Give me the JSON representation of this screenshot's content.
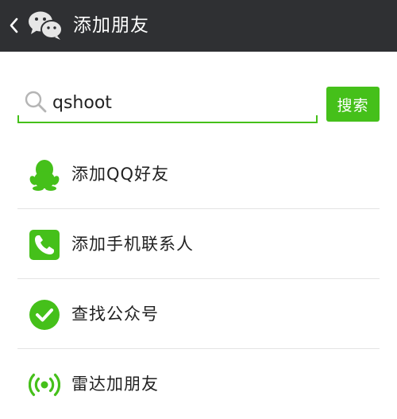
{
  "header": {
    "title": "添加朋友",
    "back_icon": "chevron-left-icon",
    "logo_icon": "wechat-logo-icon"
  },
  "search": {
    "value": "qshoot",
    "icon": "search-icon",
    "button_label": "搜索"
  },
  "menu": [
    {
      "label": "添加QQ好友",
      "icon": "qq-penguin-icon"
    },
    {
      "label": "添加手机联系人",
      "icon": "phone-icon"
    },
    {
      "label": "查找公众号",
      "icon": "checkmark-circle-icon"
    },
    {
      "label": "雷达加朋友",
      "icon": "radar-icon"
    }
  ],
  "colors": {
    "topbar_bg": "#2f3033",
    "accent": "#45c01a",
    "divider": "#e4e4e4"
  }
}
